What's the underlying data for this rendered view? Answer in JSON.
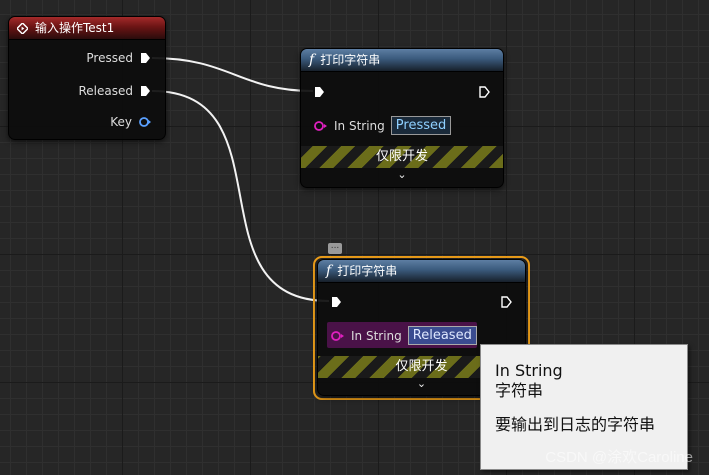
{
  "event_node": {
    "title": "输入操作Test1",
    "pins": [
      {
        "label": "Pressed"
      },
      {
        "label": "Released"
      },
      {
        "label": "Key"
      }
    ]
  },
  "print_node_1": {
    "title": "打印字符串",
    "func_symbol": "f",
    "in_string_label": "In String",
    "in_string_value": "Pressed",
    "dev_only_label": "仅限开发",
    "expand_glyph": "⌄"
  },
  "print_node_2": {
    "title": "打印字符串",
    "func_symbol": "f",
    "in_string_label": "In String",
    "in_string_value": "Released",
    "dev_only_label": "仅限开发",
    "expand_glyph": "⌄",
    "selected": true
  },
  "tooltip": {
    "line1": "In String",
    "line2": "字符串",
    "line3": "要输出到日志的字符串"
  },
  "watermark": "CSDN @涂欢Caroline",
  "colors": {
    "event_header": "#a42a2a",
    "func_header": "#3a5a7c",
    "selection": "#f0a01a",
    "string_pin": "#e020c0",
    "key_pin": "#5aa0ff",
    "wire": "#ffffff"
  }
}
